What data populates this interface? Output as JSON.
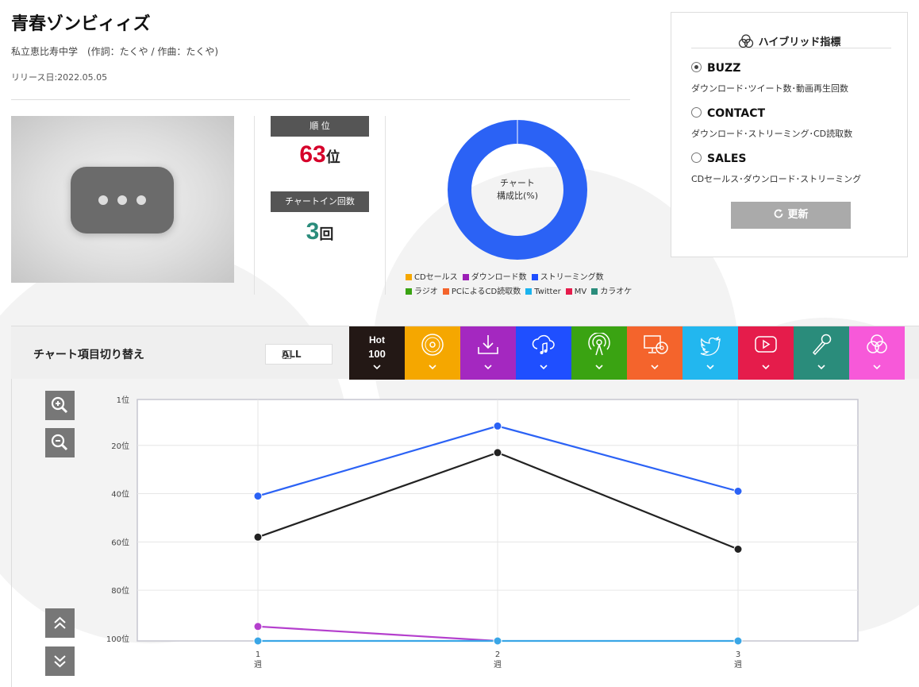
{
  "song": {
    "title": "青春ゾンビィィズ",
    "artist": "私立恵比寿中学　(作詞：たくや / 作曲：たくや)",
    "release": "リリース日:2022.05.05"
  },
  "stats": {
    "rank_label": "順 位",
    "rank_value": "63",
    "rank_unit": "位",
    "count_label": "チャートイン回数",
    "count_value": "3",
    "count_unit": "回"
  },
  "donut": {
    "center_line1": "チャート",
    "center_line2": "構成比(%)",
    "color": "#2b62f5"
  },
  "legend": {
    "row1": [
      {
        "label": "CDセールス",
        "color": "#f5a700"
      },
      {
        "label": "ダウンロード数",
        "color": "#9b1fb5"
      },
      {
        "label": "ストリーミング数",
        "color": "#1f4fff"
      }
    ],
    "row2": [
      {
        "label": "ラジオ",
        "color": "#3aa312"
      },
      {
        "label": "PCによるCD読取数",
        "color": "#f4642c"
      },
      {
        "label": "Twitter",
        "color": "#1ab3ee"
      },
      {
        "label": "MV",
        "color": "#e51c4b"
      },
      {
        "label": "カラオケ",
        "color": "#2a8c7b"
      }
    ]
  },
  "hybrid": {
    "title": "ハイブリッド指標",
    "options": [
      {
        "label": "BUZZ",
        "desc": "ダウンロード･ツイート数･動画再生回数",
        "selected": true
      },
      {
        "label": "CONTACT",
        "desc": "ダウンロード･ストリーミング･CD読取数",
        "selected": false
      },
      {
        "label": "SALES",
        "desc": "CDセールス･ダウンロード･ストリーミング",
        "selected": false
      }
    ],
    "refresh_label": "更新"
  },
  "switcher": {
    "label": "チャート項目切り替え",
    "all_label": "ALL",
    "hot_line1": "Hot",
    "hot_line2": "100",
    "tabs": [
      {
        "icon": "hot100",
        "color": "#231815"
      },
      {
        "icon": "cd-icon",
        "color": "#f5a700"
      },
      {
        "icon": "download-icon",
        "color": "#a428c0"
      },
      {
        "icon": "streaming-icon",
        "color": "#1f4fff"
      },
      {
        "icon": "radio-icon",
        "color": "#3aa312"
      },
      {
        "icon": "pc-cd-icon",
        "color": "#f4642c"
      },
      {
        "icon": "twitter-icon",
        "color": "#22b7ef"
      },
      {
        "icon": "youtube-icon",
        "color": "#e51c4b"
      },
      {
        "icon": "karaoke-icon",
        "color": "#2a8c7b"
      },
      {
        "icon": "hybrid-icon",
        "color": "#f759d9"
      }
    ]
  },
  "chart_data": {
    "type": "line",
    "x": [
      "1\n週",
      "2\n週",
      "3\n週"
    ],
    "y_ticks": [
      "1位",
      "20位",
      "40位",
      "60位",
      "80位",
      "100位"
    ],
    "ylim": [
      1,
      101
    ],
    "y_inverted": true,
    "grid": true,
    "series": [
      {
        "color": "#2b62f5",
        "values": [
          41,
          12,
          39
        ]
      },
      {
        "color": "#222222",
        "values": [
          58,
          23,
          63
        ]
      },
      {
        "color": "#b43fcd",
        "values": [
          95,
          101,
          null
        ]
      },
      {
        "color": "#3aa6e6",
        "values": [
          101,
          101,
          101
        ]
      }
    ]
  }
}
